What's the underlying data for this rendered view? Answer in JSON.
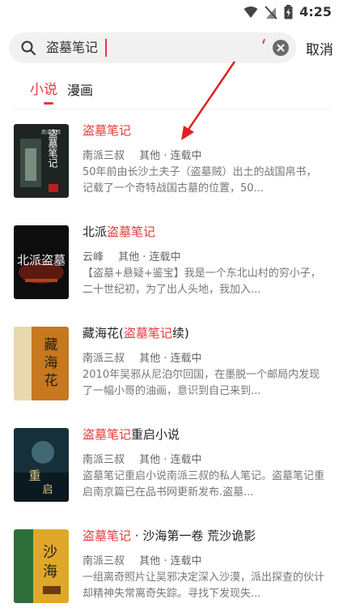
{
  "status_bar": {
    "time": "4:25"
  },
  "search": {
    "query": "盗墓笔记",
    "cancel_label": "取消"
  },
  "tabs": [
    {
      "label": "小说"
    },
    {
      "label": "漫画"
    }
  ],
  "books": [
    {
      "title_hl": "盗墓笔记",
      "title_post": "",
      "author": "南派三叔",
      "category": "其他 · 连载中",
      "desc": "50年前由长沙土夫子（盗墓贼）出土的战国帛书，记载了一个奇特战国古墓的位置，50...",
      "cover_text": "盗墓笔记",
      "cover_author": "南派三叔"
    },
    {
      "title_pre": "北派",
      "title_hl": "盗墓笔记",
      "title_post": "",
      "author": "云峰",
      "category": "其他 · 连载中",
      "desc": "【盗墓+悬疑+鉴宝】我是一个东北山村的穷小子，二十世纪初，为了出人头地，我加入...",
      "cover_text": "北派盗墓"
    },
    {
      "title_pre": "藏海花(",
      "title_hl": "盗墓笔记",
      "title_post": "续)",
      "author": "南派三叔",
      "category": "其他 · 连载中",
      "desc": "2010年吴邪从尼泊尔回国，在墨脱一个邮局内发现了一幅小哥的油画，意识到自己来到...",
      "cover_text": "藏海花"
    },
    {
      "title_pre": "",
      "title_hl": "盗墓笔记",
      "title_post": "重启小说",
      "author": "南派三叔",
      "category": "其他 · 连载中",
      "desc": "盗墓笔记重启小说南派三叔的私人笔记。盗墓笔记重启南京篇已在品书网更新发布.盗墓...",
      "cover_text": "重启"
    },
    {
      "title_pre": "",
      "title_hl": "盗墓笔记",
      "title_post": " · 沙海第一卷 荒沙诡影",
      "author": "南派三叔",
      "category": "其他 · 连载中",
      "desc": "一组离奇照片让吴邪决定深入沙漠，派出探查的伙计却精神失常离奇失踪。寻找下发现失...",
      "cover_text": "沙海"
    }
  ],
  "colors": {
    "accent": "#e63a3a",
    "search_bg": "#f1f1f1"
  }
}
